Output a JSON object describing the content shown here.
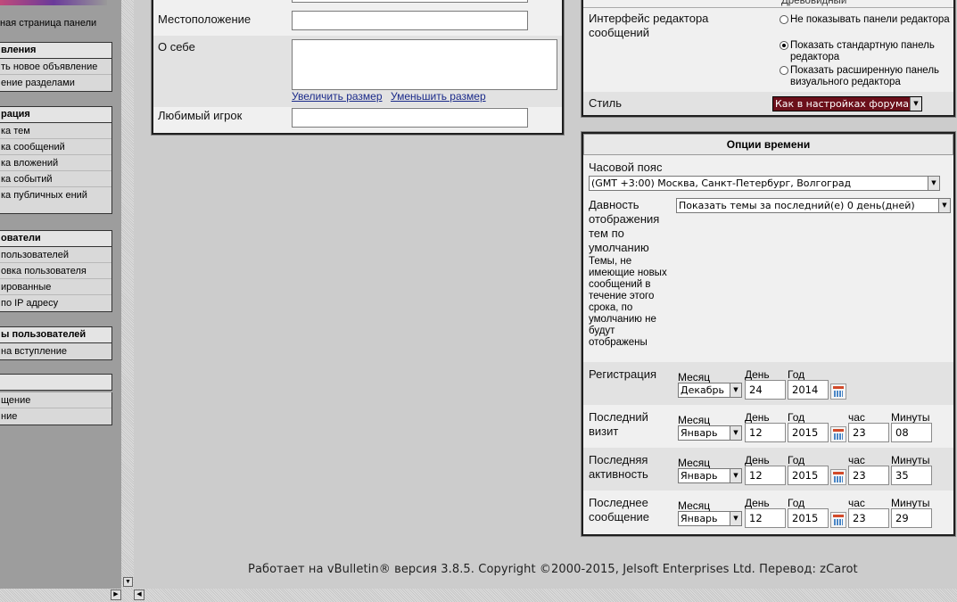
{
  "sidebar": {
    "top_link": "ная страница панели",
    "groups": [
      {
        "title": "вления",
        "items": [
          "ть новое объявление",
          "ение разделами"
        ]
      },
      {
        "title": "рация",
        "items": [
          "ка тем",
          "ка сообщений",
          "ка вложений",
          "ка событий",
          "ка публичных ений"
        ]
      },
      {
        "title": "ователи",
        "items": [
          "пользователей",
          "овка пользователя",
          "ированные",
          "по IP адресу"
        ]
      },
      {
        "title": "ы пользователей",
        "items": [
          "на вступление"
        ]
      },
      {
        "title": "",
        "items": [
          "щение",
          "ние"
        ]
      }
    ]
  },
  "profile": {
    "location_label": "Местоположение",
    "location_value": "",
    "about_label": "О себе",
    "about_value": "",
    "enlarge_link": "Увеличить размер",
    "shrink_link": "Уменьшить размер",
    "favorite_label": "Любимый игрок",
    "favorite_value": ""
  },
  "editor": {
    "top_option_cut": "Древовидный",
    "interface_label": "Интерфейс редактора сообщений",
    "options": [
      {
        "label": "Не показывать панели редактора",
        "selected": false
      },
      {
        "label": "Показать стандартную панель редактора",
        "selected": true
      },
      {
        "label": "Показать расширенную панель визуального редактора",
        "selected": false
      }
    ],
    "style_label": "Стиль",
    "style_value": "Как в настройках форума"
  },
  "time": {
    "header": "Опции времени",
    "timezone_label": "Часовой пояс",
    "timezone_value": "(GMT +3:00) Москва, Санкт-Петербург, Волгоград",
    "age_label": "Давность отображения тем по умолчанию",
    "age_desc": "Темы, не имеющие новых сообщений в течение этого срока, по умолчанию не будут отображены",
    "age_value": "Показать темы за последний(е) 0 день(дней)",
    "caps": {
      "month": "Месяц",
      "day": "День",
      "year": "Год",
      "hour": "час",
      "minute": "Минуты"
    },
    "rows": [
      {
        "label": "Регистрация",
        "month": "Декабрь",
        "day": "24",
        "year": "2014",
        "hour": null,
        "minute": null
      },
      {
        "label": "Последний визит",
        "month": "Январь",
        "day": "12",
        "year": "2015",
        "hour": "23",
        "minute": "08"
      },
      {
        "label": "Последняя активность",
        "month": "Январь",
        "day": "12",
        "year": "2015",
        "hour": "23",
        "minute": "35"
      },
      {
        "label": "Последнее сообщение",
        "month": "Январь",
        "day": "12",
        "year": "2015",
        "hour": "23",
        "minute": "29"
      }
    ]
  },
  "footer": "Работает на vBulletin® версия 3.8.5. Copyright ©2000-2015, Jelsoft Enterprises Ltd. Перевод: zCarot",
  "colors": {
    "panel_border": "#1e1e1e",
    "style_select_bg": "#6b0f1a",
    "link": "#1a2a8a"
  }
}
